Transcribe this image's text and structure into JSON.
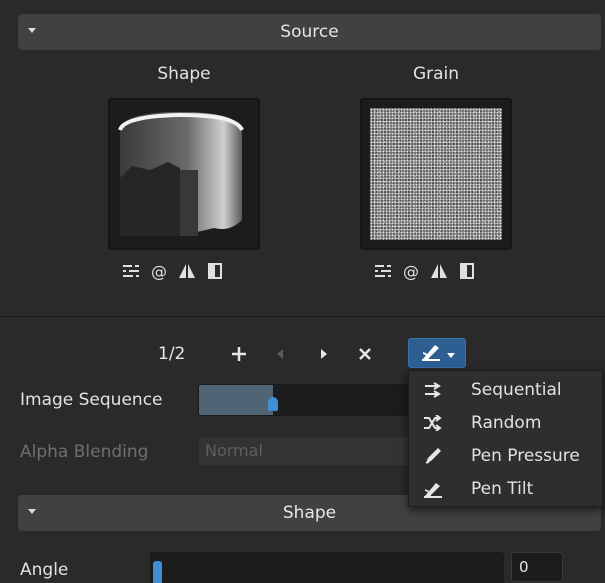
{
  "source_section": {
    "title": "Source"
  },
  "shape_column": {
    "label": "Shape"
  },
  "grain_column": {
    "label": "Grain"
  },
  "sequence": {
    "counter": "1/2"
  },
  "image_sequence": {
    "label": "Image Sequence",
    "value_fraction": 0.35
  },
  "alpha_blending": {
    "label": "Alpha Blending",
    "value": "Normal"
  },
  "shape_section": {
    "title": "Shape"
  },
  "angle": {
    "label": "Angle",
    "value": "0"
  },
  "sequence_menu": {
    "items": [
      {
        "label": "Sequential",
        "icon": "arrows-right-icon"
      },
      {
        "label": "Random",
        "icon": "shuffle-icon"
      },
      {
        "label": "Pen Pressure",
        "icon": "pen-icon"
      },
      {
        "label": "Pen Tilt",
        "icon": "pen-tilt-icon"
      }
    ]
  },
  "colors": {
    "background": "#2a2a2a",
    "header": "#414141",
    "accent": "#3f8fd6",
    "mode_button": "#2d5f93"
  }
}
